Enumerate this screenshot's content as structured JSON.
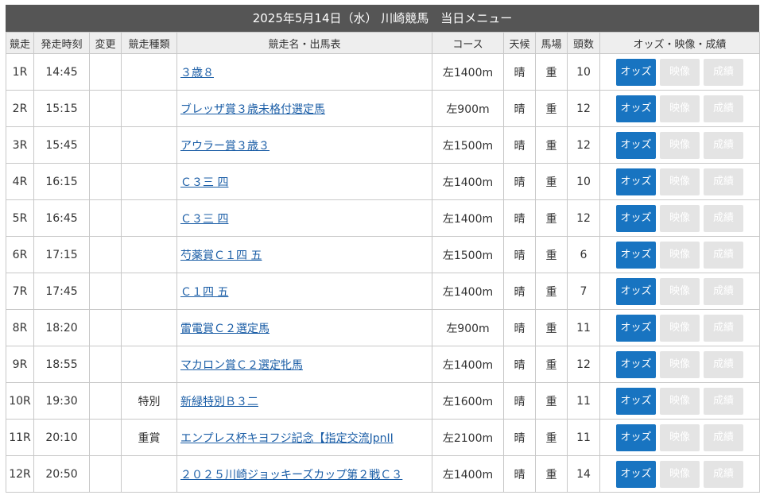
{
  "page": {
    "title": "2025年5月14日（水） 川崎競馬　当日メニュー"
  },
  "headers": {
    "race": "競走",
    "start_time": "発走時刻",
    "change": "変更",
    "race_type": "競走種類",
    "race_name": "競走名・出馬表",
    "course": "コース",
    "weather": "天候",
    "track": "馬場",
    "heads": "頭数",
    "links": "オッズ・映像・成績"
  },
  "buttons": {
    "odds": "オッズ",
    "video": "映像",
    "results": "成績"
  },
  "colors": {
    "title_bar": "#555555",
    "odds_button": "#1874c1",
    "disabled_button": "#e4e4e4",
    "link": "#1a5da6"
  },
  "races": [
    {
      "no": "1R",
      "time": "14:45",
      "change": "",
      "type": "",
      "name": "３歳８",
      "course": "左1400m",
      "weather": "晴",
      "track": "重",
      "heads": "10"
    },
    {
      "no": "2R",
      "time": "15:15",
      "change": "",
      "type": "",
      "name": "ブレッザ賞３歳未格付選定馬",
      "course": "左900m",
      "weather": "晴",
      "track": "重",
      "heads": "12"
    },
    {
      "no": "3R",
      "time": "15:45",
      "change": "",
      "type": "",
      "name": "アウラー賞３歳３",
      "course": "左1500m",
      "weather": "晴",
      "track": "重",
      "heads": "12"
    },
    {
      "no": "4R",
      "time": "16:15",
      "change": "",
      "type": "",
      "name": "Ｃ３三 四",
      "course": "左1400m",
      "weather": "晴",
      "track": "重",
      "heads": "10"
    },
    {
      "no": "5R",
      "time": "16:45",
      "change": "",
      "type": "",
      "name": "Ｃ３三 四",
      "course": "左1400m",
      "weather": "晴",
      "track": "重",
      "heads": "12"
    },
    {
      "no": "6R",
      "time": "17:15",
      "change": "",
      "type": "",
      "name": "芍薬賞Ｃ１四 五",
      "course": "左1500m",
      "weather": "晴",
      "track": "重",
      "heads": "6"
    },
    {
      "no": "7R",
      "time": "17:45",
      "change": "",
      "type": "",
      "name": "Ｃ１四 五",
      "course": "左1400m",
      "weather": "晴",
      "track": "重",
      "heads": "7"
    },
    {
      "no": "8R",
      "time": "18:20",
      "change": "",
      "type": "",
      "name": "雷電賞Ｃ２選定馬",
      "course": "左900m",
      "weather": "晴",
      "track": "重",
      "heads": "11"
    },
    {
      "no": "9R",
      "time": "18:55",
      "change": "",
      "type": "",
      "name": "マカロン賞Ｃ２選定牝馬",
      "course": "左1400m",
      "weather": "晴",
      "track": "重",
      "heads": "12"
    },
    {
      "no": "10R",
      "time": "19:30",
      "change": "",
      "type": "特別",
      "name": "新緑特別Ｂ３二",
      "course": "左1600m",
      "weather": "晴",
      "track": "重",
      "heads": "11"
    },
    {
      "no": "11R",
      "time": "20:10",
      "change": "",
      "type": "重賞",
      "name": "エンプレス杯キヨフジ記念【指定交流JpnII",
      "course": "左2100m",
      "weather": "晴",
      "track": "重",
      "heads": "11"
    },
    {
      "no": "12R",
      "time": "20:50",
      "change": "",
      "type": "",
      "name": "２０２５川崎ジョッキーズカップ第２戦Ｃ３",
      "course": "左1400m",
      "weather": "晴",
      "track": "重",
      "heads": "14"
    }
  ]
}
